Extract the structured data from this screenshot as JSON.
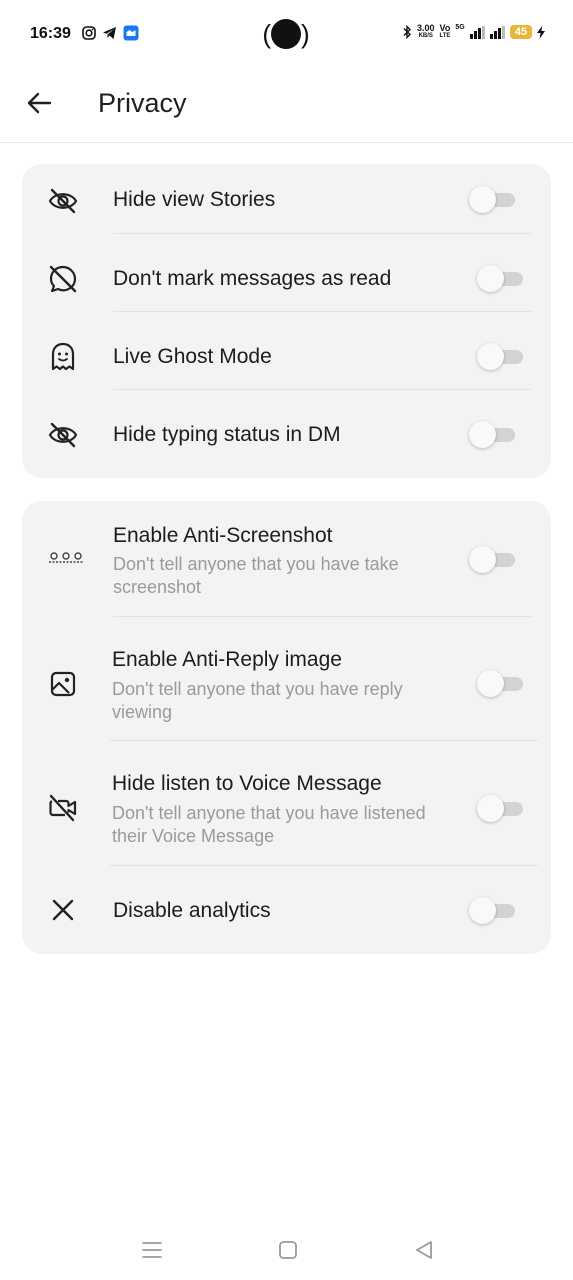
{
  "status_bar": {
    "time": "16:39",
    "left_icons": [
      "instagram-icon",
      "telegram-icon",
      "app-notification-icon"
    ],
    "speed_value": "3.00",
    "speed_unit": "KB/S",
    "volte_top": "Vo",
    "volte_bottom": "LTE",
    "network_label": "5G",
    "battery_level": "45"
  },
  "header": {
    "title": "Privacy"
  },
  "group1": {
    "items": [
      {
        "label": "Hide view Stories",
        "icon": "eye-off-icon",
        "enabled": false
      },
      {
        "label": "Don't mark messages as read",
        "icon": "message-off-icon",
        "enabled": false
      },
      {
        "label": "Live Ghost Mode",
        "icon": "ghost-icon",
        "enabled": false
      },
      {
        "label": "Hide typing status in DM",
        "icon": "eye-off-icon",
        "enabled": false
      }
    ]
  },
  "group2": {
    "items": [
      {
        "label": "Enable Anti-Screenshot",
        "subtitle": "Don't tell anyone that you have take screenshot",
        "icon": "anti-screenshot-icon",
        "enabled": false
      },
      {
        "label": "Enable Anti-Reply image",
        "subtitle": "Don't tell anyone that you have reply viewing",
        "icon": "image-icon",
        "enabled": false
      },
      {
        "label": "Hide listen to Voice Message",
        "subtitle": "Don't tell anyone that you have listened their Voice Message",
        "icon": "video-off-icon",
        "enabled": false
      },
      {
        "label": "Disable analytics",
        "icon": "close-icon",
        "enabled": false
      }
    ]
  },
  "colors": {
    "card_background": "#f3f3f3",
    "toggle_track_off": "#d3d3d3",
    "battery": "#e7b739"
  }
}
